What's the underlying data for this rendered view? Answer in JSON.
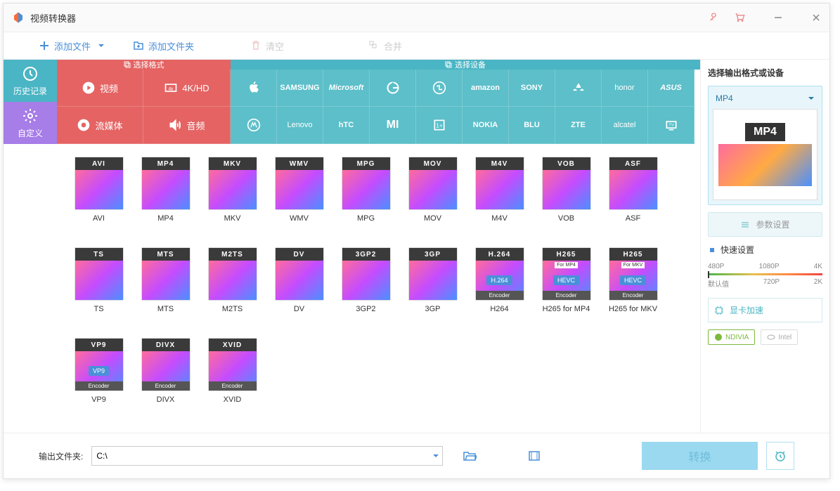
{
  "app": {
    "title": "视频转换器"
  },
  "toolbar": {
    "add_file": "添加文件",
    "add_folder": "添加文件夹",
    "clear": "清空",
    "merge": "合并"
  },
  "sidebar": {
    "history": "历史记录",
    "custom": "自定义"
  },
  "headers": {
    "format": "选择格式",
    "device": "选择设备"
  },
  "categories": {
    "video": "视频",
    "fourk": "4K/HD",
    "stream": "流媒体",
    "audio": "音频"
  },
  "brands": {
    "row1": [
      "Apple",
      "SAMSUNG",
      "Microsoft",
      "Google",
      "LG",
      "amazon",
      "SONY",
      "HUAWEI",
      "honor",
      "ASUS"
    ],
    "row2": [
      "Motorola",
      "Lenovo",
      "hTC",
      "MI",
      "OnePlus",
      "NOKIA",
      "BLU",
      "ZTE",
      "alcatel",
      "TV"
    ]
  },
  "formats": [
    {
      "badge": "AVI",
      "name": "AVI"
    },
    {
      "badge": "MP4",
      "name": "MP4"
    },
    {
      "badge": "MKV",
      "name": "MKV"
    },
    {
      "badge": "WMV",
      "name": "WMV"
    },
    {
      "badge": "MPG",
      "name": "MPG"
    },
    {
      "badge": "MOV",
      "name": "MOV"
    },
    {
      "badge": "M4V",
      "name": "M4V"
    },
    {
      "badge": "VOB",
      "name": "VOB"
    },
    {
      "badge": "ASF",
      "name": "ASF"
    },
    {
      "badge": "TS",
      "name": "TS"
    },
    {
      "badge": "MTS",
      "name": "MTS"
    },
    {
      "badge": "M2TS",
      "name": "M2TS"
    },
    {
      "badge": "DV",
      "name": "DV"
    },
    {
      "badge": "3GP2",
      "name": "3GP2"
    },
    {
      "badge": "3GP",
      "name": "3GP"
    },
    {
      "badge": "H.264",
      "name": "H264",
      "encoder": true,
      "sub": "H.264"
    },
    {
      "badge": "H265",
      "name": "H265 for MP4",
      "encoder": true,
      "sub": "HEVC",
      "sup": "For MP4"
    },
    {
      "badge": "H265",
      "name": "H265 for MKV",
      "encoder": true,
      "sub": "HEVC",
      "sup": "For MKV"
    },
    {
      "badge": "VP9",
      "name": "VP9",
      "encoder": true,
      "sub": "VP9"
    },
    {
      "badge": "DIVX",
      "name": "DIVX",
      "encoder": true
    },
    {
      "badge": "XVID",
      "name": "XVID",
      "encoder": true
    }
  ],
  "right_panel": {
    "title": "选择输出格式或设备",
    "selected": "MP4",
    "preview_label": "MP4",
    "params": "参数设置",
    "quick": "快速设置",
    "quality_labels_top": [
      "480P",
      "1080P",
      "4K"
    ],
    "quality_labels_bottom": [
      "默认值",
      "720P",
      "2K"
    ],
    "gpu": "显卡加速",
    "nvidia": "NDIVIA",
    "intel": "Intel"
  },
  "footer": {
    "output_label": "输出文件夹:",
    "output_path": "C:\\",
    "convert": "转换"
  }
}
